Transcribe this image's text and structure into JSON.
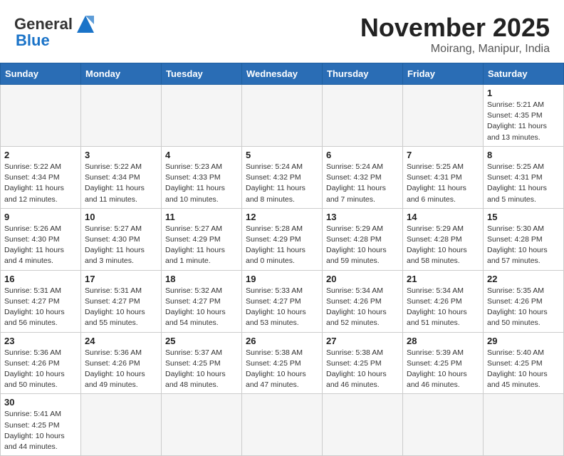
{
  "header": {
    "logo_general": "General",
    "logo_blue": "Blue",
    "month_title": "November 2025",
    "location": "Moirang, Manipur, India"
  },
  "weekdays": [
    "Sunday",
    "Monday",
    "Tuesday",
    "Wednesday",
    "Thursday",
    "Friday",
    "Saturday"
  ],
  "weeks": [
    [
      {
        "day": "",
        "info": ""
      },
      {
        "day": "",
        "info": ""
      },
      {
        "day": "",
        "info": ""
      },
      {
        "day": "",
        "info": ""
      },
      {
        "day": "",
        "info": ""
      },
      {
        "day": "",
        "info": ""
      },
      {
        "day": "1",
        "info": "Sunrise: 5:21 AM\nSunset: 4:35 PM\nDaylight: 11 hours\nand 13 minutes."
      }
    ],
    [
      {
        "day": "2",
        "info": "Sunrise: 5:22 AM\nSunset: 4:34 PM\nDaylight: 11 hours\nand 12 minutes."
      },
      {
        "day": "3",
        "info": "Sunrise: 5:22 AM\nSunset: 4:34 PM\nDaylight: 11 hours\nand 11 minutes."
      },
      {
        "day": "4",
        "info": "Sunrise: 5:23 AM\nSunset: 4:33 PM\nDaylight: 11 hours\nand 10 minutes."
      },
      {
        "day": "5",
        "info": "Sunrise: 5:24 AM\nSunset: 4:32 PM\nDaylight: 11 hours\nand 8 minutes."
      },
      {
        "day": "6",
        "info": "Sunrise: 5:24 AM\nSunset: 4:32 PM\nDaylight: 11 hours\nand 7 minutes."
      },
      {
        "day": "7",
        "info": "Sunrise: 5:25 AM\nSunset: 4:31 PM\nDaylight: 11 hours\nand 6 minutes."
      },
      {
        "day": "8",
        "info": "Sunrise: 5:25 AM\nSunset: 4:31 PM\nDaylight: 11 hours\nand 5 minutes."
      }
    ],
    [
      {
        "day": "9",
        "info": "Sunrise: 5:26 AM\nSunset: 4:30 PM\nDaylight: 11 hours\nand 4 minutes."
      },
      {
        "day": "10",
        "info": "Sunrise: 5:27 AM\nSunset: 4:30 PM\nDaylight: 11 hours\nand 3 minutes."
      },
      {
        "day": "11",
        "info": "Sunrise: 5:27 AM\nSunset: 4:29 PM\nDaylight: 11 hours\nand 1 minute."
      },
      {
        "day": "12",
        "info": "Sunrise: 5:28 AM\nSunset: 4:29 PM\nDaylight: 11 hours\nand 0 minutes."
      },
      {
        "day": "13",
        "info": "Sunrise: 5:29 AM\nSunset: 4:28 PM\nDaylight: 10 hours\nand 59 minutes."
      },
      {
        "day": "14",
        "info": "Sunrise: 5:29 AM\nSunset: 4:28 PM\nDaylight: 10 hours\nand 58 minutes."
      },
      {
        "day": "15",
        "info": "Sunrise: 5:30 AM\nSunset: 4:28 PM\nDaylight: 10 hours\nand 57 minutes."
      }
    ],
    [
      {
        "day": "16",
        "info": "Sunrise: 5:31 AM\nSunset: 4:27 PM\nDaylight: 10 hours\nand 56 minutes."
      },
      {
        "day": "17",
        "info": "Sunrise: 5:31 AM\nSunset: 4:27 PM\nDaylight: 10 hours\nand 55 minutes."
      },
      {
        "day": "18",
        "info": "Sunrise: 5:32 AM\nSunset: 4:27 PM\nDaylight: 10 hours\nand 54 minutes."
      },
      {
        "day": "19",
        "info": "Sunrise: 5:33 AM\nSunset: 4:27 PM\nDaylight: 10 hours\nand 53 minutes."
      },
      {
        "day": "20",
        "info": "Sunrise: 5:34 AM\nSunset: 4:26 PM\nDaylight: 10 hours\nand 52 minutes."
      },
      {
        "day": "21",
        "info": "Sunrise: 5:34 AM\nSunset: 4:26 PM\nDaylight: 10 hours\nand 51 minutes."
      },
      {
        "day": "22",
        "info": "Sunrise: 5:35 AM\nSunset: 4:26 PM\nDaylight: 10 hours\nand 50 minutes."
      }
    ],
    [
      {
        "day": "23",
        "info": "Sunrise: 5:36 AM\nSunset: 4:26 PM\nDaylight: 10 hours\nand 50 minutes."
      },
      {
        "day": "24",
        "info": "Sunrise: 5:36 AM\nSunset: 4:26 PM\nDaylight: 10 hours\nand 49 minutes."
      },
      {
        "day": "25",
        "info": "Sunrise: 5:37 AM\nSunset: 4:25 PM\nDaylight: 10 hours\nand 48 minutes."
      },
      {
        "day": "26",
        "info": "Sunrise: 5:38 AM\nSunset: 4:25 PM\nDaylight: 10 hours\nand 47 minutes."
      },
      {
        "day": "27",
        "info": "Sunrise: 5:38 AM\nSunset: 4:25 PM\nDaylight: 10 hours\nand 46 minutes."
      },
      {
        "day": "28",
        "info": "Sunrise: 5:39 AM\nSunset: 4:25 PM\nDaylight: 10 hours\nand 46 minutes."
      },
      {
        "day": "29",
        "info": "Sunrise: 5:40 AM\nSunset: 4:25 PM\nDaylight: 10 hours\nand 45 minutes."
      }
    ],
    [
      {
        "day": "30",
        "info": "Sunrise: 5:41 AM\nSunset: 4:25 PM\nDaylight: 10 hours\nand 44 minutes."
      },
      {
        "day": "",
        "info": ""
      },
      {
        "day": "",
        "info": ""
      },
      {
        "day": "",
        "info": ""
      },
      {
        "day": "",
        "info": ""
      },
      {
        "day": "",
        "info": ""
      },
      {
        "day": "",
        "info": ""
      }
    ]
  ]
}
